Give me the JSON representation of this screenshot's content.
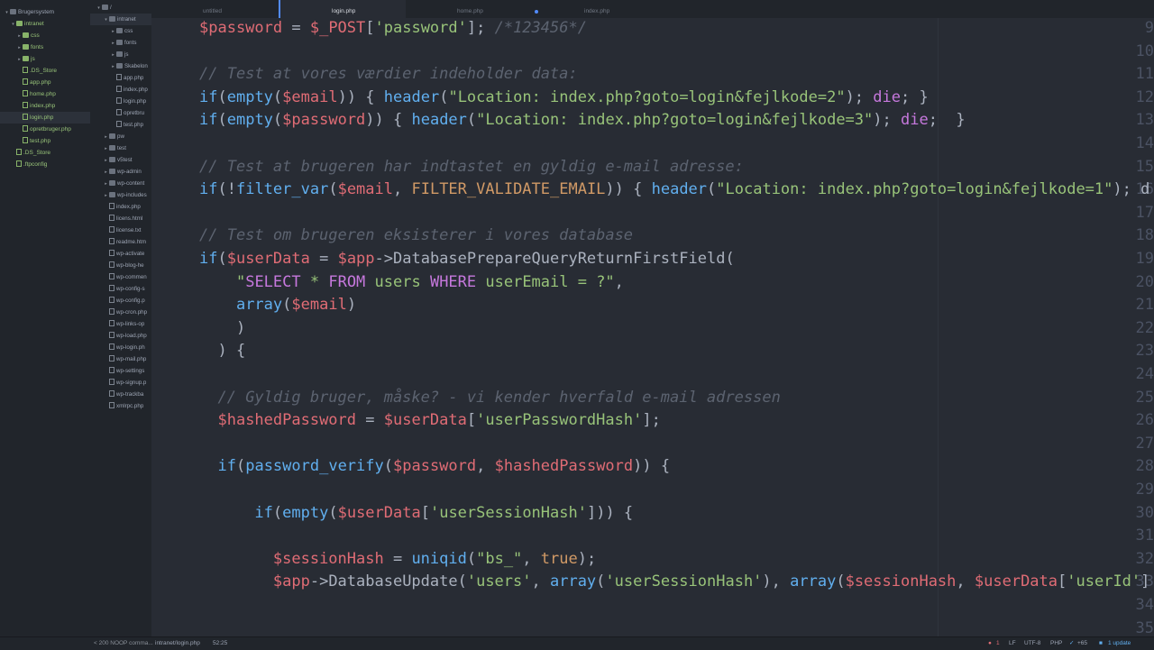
{
  "project_tree": {
    "items": [
      {
        "label": "Brugersystem",
        "kind": "folder",
        "depth": 0,
        "expanded": true,
        "color": "grey"
      },
      {
        "label": "intranet",
        "kind": "folder",
        "depth": 1,
        "expanded": true,
        "color": "green"
      },
      {
        "label": "css",
        "kind": "folder",
        "depth": 2,
        "expanded": false,
        "color": "green"
      },
      {
        "label": "fonts",
        "kind": "folder",
        "depth": 2,
        "expanded": false,
        "color": "green"
      },
      {
        "label": "js",
        "kind": "folder",
        "depth": 2,
        "expanded": false,
        "color": "green"
      },
      {
        "label": ".DS_Store",
        "kind": "file",
        "depth": 2,
        "color": "green"
      },
      {
        "label": "app.php",
        "kind": "file",
        "depth": 2,
        "color": "green"
      },
      {
        "label": "home.php",
        "kind": "file",
        "depth": 2,
        "color": "green"
      },
      {
        "label": "index.php",
        "kind": "file",
        "depth": 2,
        "color": "green"
      },
      {
        "label": "login.php",
        "kind": "file",
        "depth": 2,
        "color": "green",
        "selected": true
      },
      {
        "label": "opretbruger.php",
        "kind": "file",
        "depth": 2,
        "color": "green"
      },
      {
        "label": "test.php",
        "kind": "file",
        "depth": 2,
        "color": "green"
      },
      {
        "label": ".DS_Store",
        "kind": "file",
        "depth": 1,
        "color": "green"
      },
      {
        "label": ".ftpconfig",
        "kind": "file",
        "depth": 1,
        "color": "green"
      }
    ]
  },
  "remote_tree": {
    "items": [
      {
        "label": "/",
        "kind": "folder",
        "depth": 0,
        "expanded": true
      },
      {
        "label": "intranet",
        "kind": "folder",
        "depth": 1,
        "expanded": true,
        "selected": true
      },
      {
        "label": "css",
        "kind": "folder",
        "depth": 2,
        "expanded": false
      },
      {
        "label": "fonts",
        "kind": "folder",
        "depth": 2,
        "expanded": false
      },
      {
        "label": "js",
        "kind": "folder",
        "depth": 2,
        "expanded": false
      },
      {
        "label": "Skabelon",
        "kind": "folder",
        "depth": 2,
        "expanded": false
      },
      {
        "label": "app.php",
        "kind": "file",
        "depth": 2
      },
      {
        "label": "index.php",
        "kind": "file",
        "depth": 2
      },
      {
        "label": "login.php",
        "kind": "file",
        "depth": 2
      },
      {
        "label": "opretbru",
        "kind": "file",
        "depth": 2
      },
      {
        "label": "test.php",
        "kind": "file",
        "depth": 2
      },
      {
        "label": "pw",
        "kind": "folder",
        "depth": 1,
        "expanded": false
      },
      {
        "label": "test",
        "kind": "folder",
        "depth": 1,
        "expanded": false
      },
      {
        "label": "v5test",
        "kind": "folder",
        "depth": 1,
        "expanded": false
      },
      {
        "label": "wp-admin",
        "kind": "folder",
        "depth": 1,
        "expanded": false
      },
      {
        "label": "wp-content",
        "kind": "folder",
        "depth": 1,
        "expanded": false
      },
      {
        "label": "wp-includes",
        "kind": "folder",
        "depth": 1,
        "expanded": false
      },
      {
        "label": "index.php",
        "kind": "file",
        "depth": 1
      },
      {
        "label": "licens.html",
        "kind": "file",
        "depth": 1
      },
      {
        "label": "license.txt",
        "kind": "file",
        "depth": 1
      },
      {
        "label": "readme.htm",
        "kind": "file",
        "depth": 1
      },
      {
        "label": "wp-activate",
        "kind": "file",
        "depth": 1
      },
      {
        "label": "wp-blog-he",
        "kind": "file",
        "depth": 1
      },
      {
        "label": "wp-commen",
        "kind": "file",
        "depth": 1
      },
      {
        "label": "wp-config-s",
        "kind": "file",
        "depth": 1
      },
      {
        "label": "wp-config.p",
        "kind": "file",
        "depth": 1
      },
      {
        "label": "wp-cron.php",
        "kind": "file",
        "depth": 1
      },
      {
        "label": "wp-links-op",
        "kind": "file",
        "depth": 1
      },
      {
        "label": "wp-load.php",
        "kind": "file",
        "depth": 1
      },
      {
        "label": "wp-login.ph",
        "kind": "file",
        "depth": 1
      },
      {
        "label": "wp-mail.php",
        "kind": "file",
        "depth": 1
      },
      {
        "label": "wp-settings",
        "kind": "file",
        "depth": 1
      },
      {
        "label": "wp-signup.p",
        "kind": "file",
        "depth": 1
      },
      {
        "label": "wp-trackba",
        "kind": "file",
        "depth": 1
      },
      {
        "label": "xmlrpc.php",
        "kind": "file",
        "depth": 1
      }
    ]
  },
  "tabs": [
    {
      "label": "untitled",
      "active": false,
      "modified": false
    },
    {
      "label": "login.php",
      "active": true,
      "modified": false
    },
    {
      "label": "home.php",
      "active": false,
      "modified": true
    },
    {
      "label": "index.php",
      "active": false,
      "modified": false
    }
  ],
  "editor": {
    "lines": [
      {
        "n": "9",
        "tokens": [
          [
            "v",
            "$password"
          ],
          [
            "p",
            " = "
          ],
          [
            "v",
            "$_POST"
          ],
          [
            "p",
            "["
          ],
          [
            "s",
            "'password'"
          ],
          [
            "p",
            "]; "
          ],
          [
            "c",
            "/*123456*/"
          ]
        ]
      },
      {
        "n": "10",
        "tokens": []
      },
      {
        "n": "11",
        "tokens": [
          [
            "c",
            "// Test at vores værdier indeholder data:"
          ]
        ]
      },
      {
        "n": "12",
        "tokens": [
          [
            "f",
            "if"
          ],
          [
            "p",
            "("
          ],
          [
            "f",
            "empty"
          ],
          [
            "p",
            "("
          ],
          [
            "v",
            "$email"
          ],
          [
            "p",
            ")) { "
          ],
          [
            "f",
            "header"
          ],
          [
            "p",
            "("
          ],
          [
            "s",
            "\"Location: index.php?goto=login&fejlkode=2\""
          ],
          [
            "p",
            "); "
          ],
          [
            "k",
            "die"
          ],
          [
            "p",
            "; }"
          ]
        ]
      },
      {
        "n": "13",
        "tokens": [
          [
            "f",
            "if"
          ],
          [
            "p",
            "("
          ],
          [
            "f",
            "empty"
          ],
          [
            "p",
            "("
          ],
          [
            "v",
            "$password"
          ],
          [
            "p",
            ")) { "
          ],
          [
            "f",
            "header"
          ],
          [
            "p",
            "("
          ],
          [
            "s",
            "\"Location: index.php?goto=login&fejlkode=3\""
          ],
          [
            "p",
            "); "
          ],
          [
            "k",
            "die"
          ],
          [
            "p",
            ";  }"
          ]
        ]
      },
      {
        "n": "14",
        "tokens": []
      },
      {
        "n": "15",
        "tokens": [
          [
            "c",
            "// Test at brugeren har indtastet en gyldig e-mail adresse:"
          ]
        ]
      },
      {
        "n": "16",
        "tokens": [
          [
            "f",
            "if"
          ],
          [
            "p",
            "(!"
          ],
          [
            "f",
            "filter_var"
          ],
          [
            "p",
            "("
          ],
          [
            "v",
            "$email"
          ],
          [
            "p",
            ", "
          ],
          [
            "o",
            "FILTER_VALIDATE_EMAIL"
          ],
          [
            "p",
            ")) { "
          ],
          [
            "f",
            "header"
          ],
          [
            "p",
            "("
          ],
          [
            "s",
            "\"Location: index.php?goto=login&fejlkode=1\""
          ],
          [
            "p",
            "); d"
          ]
        ]
      },
      {
        "n": "17",
        "tokens": []
      },
      {
        "n": "18",
        "tokens": [
          [
            "c",
            "// Test om brugeren eksisterer i vores database"
          ]
        ]
      },
      {
        "n": "19",
        "tokens": [
          [
            "f",
            "if"
          ],
          [
            "p",
            "("
          ],
          [
            "v",
            "$userData"
          ],
          [
            "p",
            " = "
          ],
          [
            "v",
            "$app"
          ],
          [
            "p",
            "->DatabasePrepareQueryReturnFirstField("
          ]
        ]
      },
      {
        "n": "20",
        "tokens": [
          [
            "p",
            "    "
          ],
          [
            "s",
            "\""
          ],
          [
            "k",
            "SELECT"
          ],
          [
            "s",
            " * "
          ],
          [
            "k",
            "FROM"
          ],
          [
            "s",
            " users "
          ],
          [
            "k",
            "WHERE"
          ],
          [
            "s",
            " userEmail = ?\""
          ],
          [
            "p",
            ","
          ]
        ]
      },
      {
        "n": "21",
        "tokens": [
          [
            "p",
            "    "
          ],
          [
            "f",
            "array"
          ],
          [
            "p",
            "("
          ],
          [
            "v",
            "$email"
          ],
          [
            "p",
            ")"
          ]
        ]
      },
      {
        "n": "22",
        "tokens": [
          [
            "p",
            "    )"
          ]
        ]
      },
      {
        "n": "23",
        "tokens": [
          [
            "p",
            "  ) {"
          ]
        ]
      },
      {
        "n": "24",
        "tokens": []
      },
      {
        "n": "25",
        "tokens": [
          [
            "p",
            "  "
          ],
          [
            "c",
            "// Gyldig bruger, måske? - vi kender hverfald e-mail adressen"
          ]
        ]
      },
      {
        "n": "26",
        "tokens": [
          [
            "p",
            "  "
          ],
          [
            "v",
            "$hashedPassword"
          ],
          [
            "p",
            " = "
          ],
          [
            "v",
            "$userData"
          ],
          [
            "p",
            "["
          ],
          [
            "s",
            "'userPasswordHash'"
          ],
          [
            "p",
            "];"
          ]
        ]
      },
      {
        "n": "27",
        "tokens": []
      },
      {
        "n": "28",
        "tokens": [
          [
            "p",
            "  "
          ],
          [
            "f",
            "if"
          ],
          [
            "p",
            "("
          ],
          [
            "f",
            "password_verify"
          ],
          [
            "p",
            "("
          ],
          [
            "v",
            "$password"
          ],
          [
            "p",
            ", "
          ],
          [
            "v",
            "$hashedPassword"
          ],
          [
            "p",
            ")) {"
          ]
        ]
      },
      {
        "n": "29",
        "tokens": []
      },
      {
        "n": "30",
        "tokens": [
          [
            "p",
            "      "
          ],
          [
            "f",
            "if"
          ],
          [
            "p",
            "("
          ],
          [
            "f",
            "empty"
          ],
          [
            "p",
            "("
          ],
          [
            "v",
            "$userData"
          ],
          [
            "p",
            "["
          ],
          [
            "s",
            "'userSessionHash'"
          ],
          [
            "p",
            "])) {"
          ]
        ]
      },
      {
        "n": "31",
        "tokens": []
      },
      {
        "n": "32",
        "tokens": [
          [
            "p",
            "        "
          ],
          [
            "v",
            "$sessionHash"
          ],
          [
            "p",
            " = "
          ],
          [
            "f",
            "uniqid"
          ],
          [
            "p",
            "("
          ],
          [
            "s",
            "\"bs_\""
          ],
          [
            "p",
            ", "
          ],
          [
            "o",
            "true"
          ],
          [
            "p",
            ");"
          ]
        ]
      },
      {
        "n": "33",
        "tokens": [
          [
            "p",
            "        "
          ],
          [
            "v",
            "$app"
          ],
          [
            "p",
            "->DatabaseUpdate("
          ],
          [
            "s",
            "'users'"
          ],
          [
            "p",
            ", "
          ],
          [
            "f",
            "array"
          ],
          [
            "p",
            "("
          ],
          [
            "s",
            "'userSessionHash'"
          ],
          [
            "p",
            "), "
          ],
          [
            "f",
            "array"
          ],
          [
            "p",
            "("
          ],
          [
            "v",
            "$sessionHash"
          ],
          [
            "p",
            ", "
          ],
          [
            "v",
            "$userData"
          ],
          [
            "p",
            "["
          ],
          [
            "s",
            "'userId'"
          ],
          [
            "p",
            "]"
          ]
        ]
      },
      {
        "n": "34",
        "tokens": []
      },
      {
        "n": "35",
        "tokens": []
      }
    ]
  },
  "status": {
    "left_msg": "< 200 NOOP comma...",
    "file_path": "intranet/login.php",
    "cursor": "52:25",
    "issues": "1",
    "line_ending": "LF",
    "encoding": "UTF-8",
    "grammar": "PHP",
    "git": "+65",
    "updates": "1 update"
  },
  "colors": {
    "variable": "#e06c75",
    "function": "#61afef",
    "string": "#98c379",
    "keyword": "#c678dd",
    "comment": "#5c6370",
    "constant": "#d19a66",
    "accent": "#528bff"
  }
}
